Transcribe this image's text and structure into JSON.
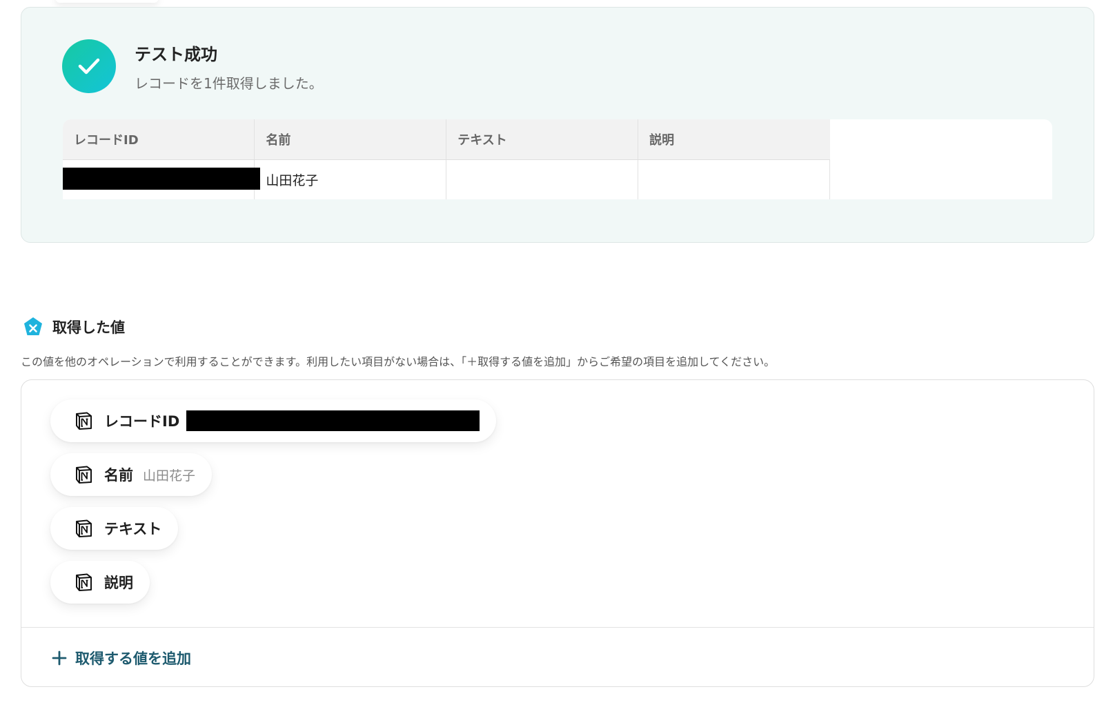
{
  "success": {
    "title": "テスト成功",
    "message": "レコードを1件取得しました。"
  },
  "result_table": {
    "columns": [
      "レコードID",
      "名前",
      "テキスト",
      "説明"
    ],
    "rows": [
      {
        "record_id": "[redacted]",
        "name": "山田花子",
        "text": "",
        "description": ""
      }
    ]
  },
  "obtained_values": {
    "title": "取得した値",
    "description": "この値を他のオペレーションで利用することができます。利用したい項目がない場合は、「＋取得する値を追加」からご希望の項目を追加してください。",
    "items": [
      {
        "label": "レコードID",
        "value": "[redacted]",
        "icon": "notion-icon"
      },
      {
        "label": "名前",
        "value": "山田花子",
        "icon": "notion-icon"
      },
      {
        "label": "テキスト",
        "value": "",
        "icon": "notion-icon"
      },
      {
        "label": "説明",
        "value": "",
        "icon": "notion-icon"
      }
    ],
    "add_button_label": "取得する値を追加"
  },
  "colors": {
    "success_gradient_start": "#16c9a2",
    "success_gradient_end": "#14c4d8",
    "panel_background": "#f1f8f7",
    "add_button_text": "#1d5a6e",
    "section_icon": "#1fb3dd"
  }
}
